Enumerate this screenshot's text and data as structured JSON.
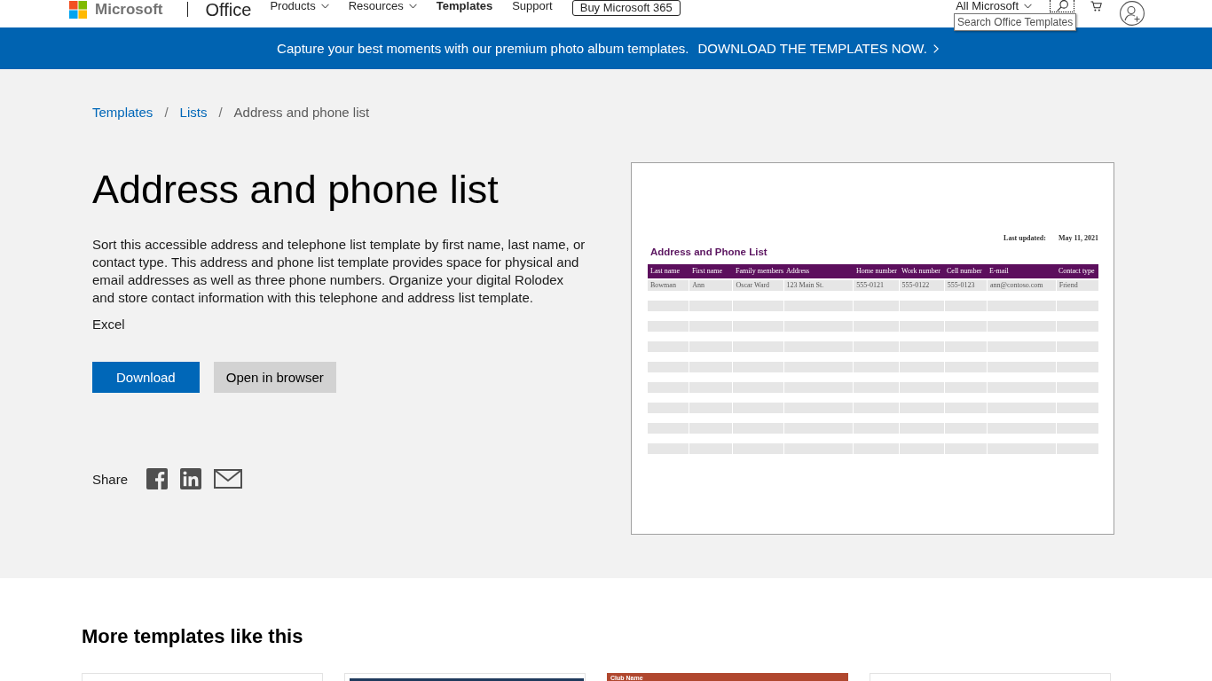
{
  "header": {
    "brand": "Microsoft",
    "product": "Office",
    "nav": [
      {
        "label": "Products",
        "has_menu": true,
        "selected": false
      },
      {
        "label": "Resources",
        "has_menu": true,
        "selected": false
      },
      {
        "label": "Templates",
        "has_menu": false,
        "selected": true
      },
      {
        "label": "Support",
        "has_menu": false,
        "selected": false
      }
    ],
    "buy_button": "Buy Microsoft 365",
    "all_menu": "All Microsoft",
    "search_tooltip": "Search Office Templates"
  },
  "banner": {
    "text": "Capture your best moments with our premium photo album templates.",
    "link": "DOWNLOAD THE TEMPLATES NOW."
  },
  "breadcrumb": [
    {
      "kind": "link",
      "label": "Templates"
    },
    {
      "kind": "separator",
      "label": "/"
    },
    {
      "kind": "link",
      "label": "Lists"
    },
    {
      "kind": "separator",
      "label": "/"
    },
    {
      "kind": "current",
      "label": "Address and phone list"
    }
  ],
  "template": {
    "title": "Address and phone list",
    "description": "Sort this accessible address and telephone list template by first name, last name, or contact type. This address and phone list template provides space for physical and email addresses as well as three phone numbers. Organize your digital Rolodex and store contact information with this telephone and address list template.",
    "app": "Excel",
    "buttons": [
      {
        "kind": "primary",
        "label": "Download"
      },
      {
        "kind": "secondary",
        "label": "Open in browser"
      }
    ],
    "share_label": "Share"
  },
  "preview": {
    "title": "Address and Phone List",
    "updated_label": "Last updated:",
    "updated_value": "May 11, 2021",
    "columns": [
      "Last name",
      "First name",
      "Family members",
      "Address",
      "Home number",
      "Work number",
      "Cell number",
      "E-mail",
      "Contact type"
    ],
    "rows": [
      {
        "kind": "data",
        "cells": [
          "Bowman",
          "Ann",
          "Oscar Ward",
          "123 Main St.",
          "555-0121",
          "555-0122",
          "555-0123",
          "ann@contoso.com",
          "Friend"
        ]
      },
      {
        "kind": "blank"
      },
      {
        "kind": "blank"
      },
      {
        "kind": "blank"
      },
      {
        "kind": "blank"
      },
      {
        "kind": "blank"
      },
      {
        "kind": "blank"
      },
      {
        "kind": "blank"
      },
      {
        "kind": "blank"
      }
    ]
  },
  "related": {
    "heading": "More templates like this",
    "cards": [
      {
        "kind": "plain"
      },
      {
        "kind": "inset_band",
        "color": "#1f3a5c"
      },
      {
        "kind": "top_band",
        "color": "#b0472e",
        "title": "Club Name"
      },
      {
        "kind": "plain"
      }
    ]
  }
}
